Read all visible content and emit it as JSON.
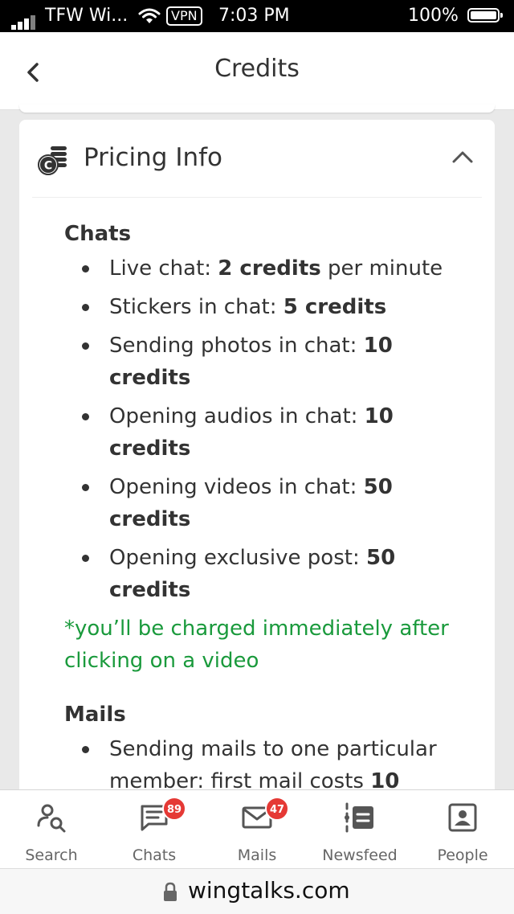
{
  "status_bar": {
    "carrier": "TFW Wi...",
    "vpn": "VPN",
    "time": "7:03 PM",
    "battery": "100%"
  },
  "header": {
    "title": "Credits",
    "back_icon": "chevron-left-icon"
  },
  "card": {
    "title": "Pricing Info",
    "icon": "coins-icon",
    "collapse_icon": "chevron-up-icon",
    "chats": {
      "title": "Chats",
      "items": [
        {
          "label": "Live chat: ",
          "value": "2 credits",
          "suffix": " per minute"
        },
        {
          "label": "Stickers in chat: ",
          "value": "5 credits",
          "suffix": ""
        },
        {
          "label": "Sending photos in chat: ",
          "value": "10 credits",
          "suffix": ""
        },
        {
          "label": "Opening audios in chat: ",
          "value": "10 credits",
          "suffix": ""
        },
        {
          "label": "Opening videos in chat: ",
          "value": "50 credits",
          "suffix": ""
        },
        {
          "label": "Opening exclusive post: ",
          "value": "50 credits",
          "suffix": ""
        }
      ],
      "note": "*you’ll be charged immediately after clicking on a video"
    },
    "mails": {
      "title": "Mails",
      "items": [
        {
          "label": "Sending mails to one particular member: first mail costs ",
          "value": "10",
          "suffix": ""
        }
      ]
    }
  },
  "tabs": [
    {
      "label": "Search",
      "icon": "search-people-icon",
      "badge": ""
    },
    {
      "label": "Chats",
      "icon": "chat-icon",
      "badge": "89"
    },
    {
      "label": "Mails",
      "icon": "mail-icon",
      "badge": "47"
    },
    {
      "label": "Newsfeed",
      "icon": "newsfeed-icon",
      "badge": ""
    },
    {
      "label": "People",
      "icon": "people-icon",
      "badge": ""
    }
  ],
  "url_bar": {
    "url": "wingtalks.com",
    "icon": "lock-icon"
  }
}
